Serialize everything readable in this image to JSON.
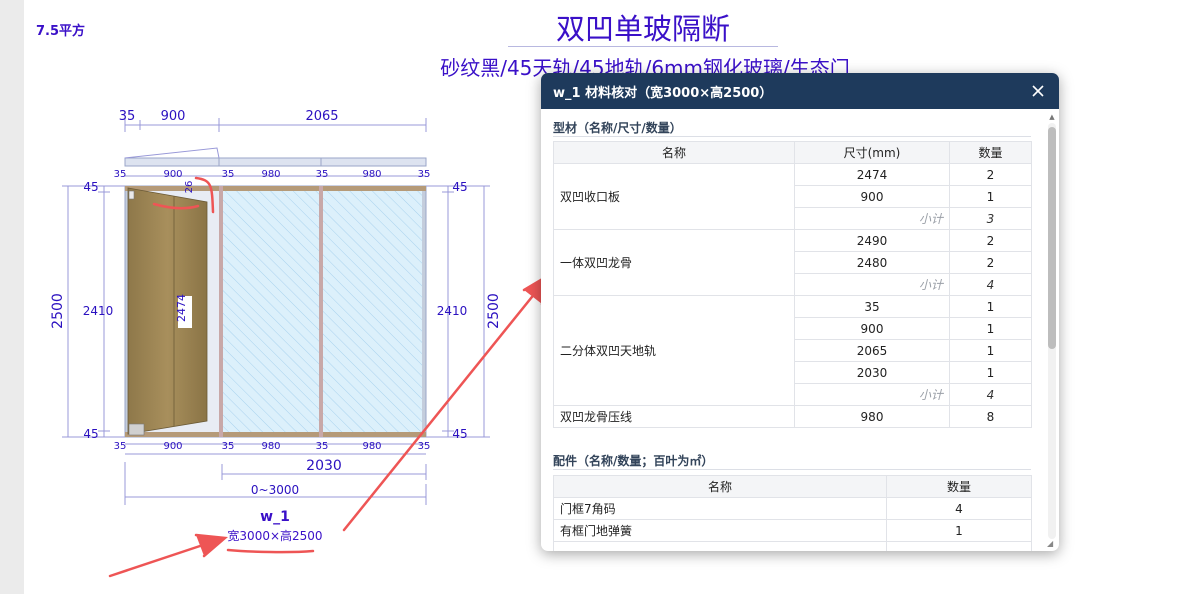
{
  "area_label": "7.5平方",
  "title": "双凹单玻隔断",
  "subtitle": "砂纹黑/45天轨/45地轨/6mm钢化玻璃/生态门",
  "drawing": {
    "top_dims": [
      "35",
      "900",
      "2065"
    ],
    "frame_top_dims": [
      "35",
      "900",
      "26",
      "35",
      "980",
      "35",
      "980",
      "35"
    ],
    "frame_bottom_dims": [
      "35",
      "900",
      "35",
      "980",
      "35",
      "980",
      "35"
    ],
    "left_dims": [
      "45",
      "2410",
      "45"
    ],
    "right_dims": [
      "45",
      "2410",
      "45"
    ],
    "total_height": "2500",
    "door_height": "2474",
    "bottom_dim_1": "2030",
    "bottom_dim_2": "0~3000",
    "code": "w_1",
    "size_text": "宽3000×高2500"
  },
  "modal": {
    "title": "w_1 材料核对（宽3000×高2500）",
    "profiles_title": "型材（名称/尺寸/数量）",
    "profiles_headers": [
      "名称",
      "尺寸(mm)",
      "数量"
    ],
    "subtotal_label": "小计",
    "profiles": [
      {
        "name": "双凹收口板",
        "rows": [
          {
            "size": "2474",
            "qty": "2"
          },
          {
            "size": "900",
            "qty": "1"
          }
        ],
        "subtotal": "3"
      },
      {
        "name": "一体双凹龙骨",
        "rows": [
          {
            "size": "2490",
            "qty": "2"
          },
          {
            "size": "2480",
            "qty": "2"
          }
        ],
        "subtotal": "4"
      },
      {
        "name": "二分体双凹天地轨",
        "rows": [
          {
            "size": "35",
            "qty": "1"
          },
          {
            "size": "900",
            "qty": "1"
          },
          {
            "size": "2065",
            "qty": "1"
          },
          {
            "size": "2030",
            "qty": "1"
          }
        ],
        "subtotal": "4"
      },
      {
        "name": "双凹龙骨压线",
        "rows": [
          {
            "size": "980",
            "qty": "8"
          }
        ],
        "subtotal": null
      }
    ],
    "fittings_title": "配件（名称/数量；百叶为㎡）",
    "fittings_headers": [
      "名称",
      "数量"
    ],
    "fittings": [
      {
        "name": "门框7角码",
        "qty": "4"
      },
      {
        "name": "有框门地弹簧",
        "qty": "1"
      }
    ]
  },
  "colors": {
    "title": "#3a10c8",
    "dimension": "#2a10c0",
    "dim_line": "#9898d8",
    "door": "#9b8452",
    "glass": "#d8eefa",
    "frame": "#b8c4d8",
    "arrow": "#ee5555",
    "modal_header": "#1e3a5c"
  }
}
